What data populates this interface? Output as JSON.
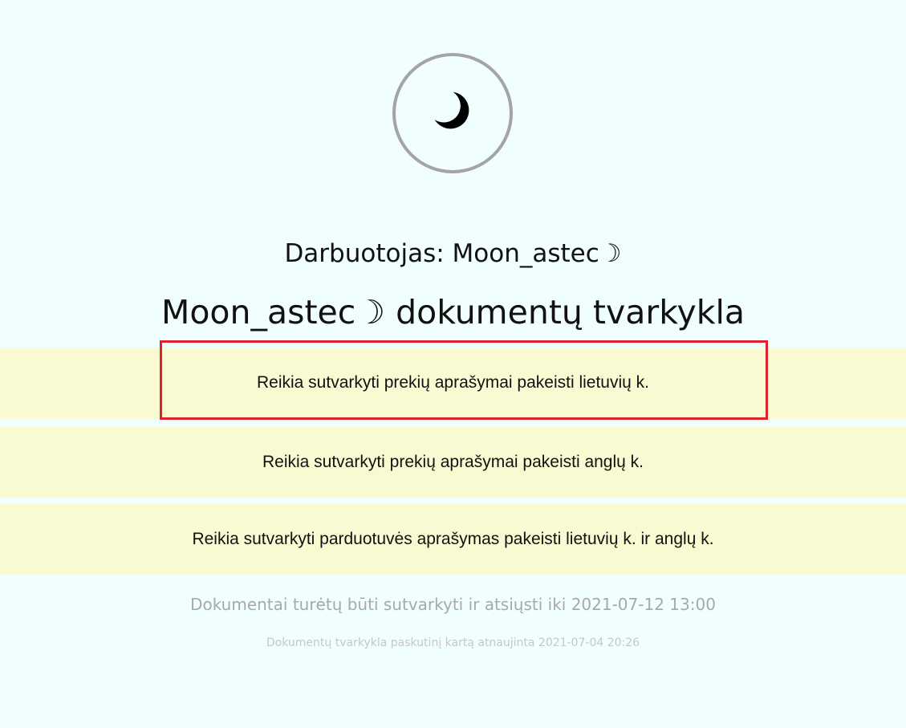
{
  "avatar": {
    "icon": "crescent-moon-icon"
  },
  "worker": {
    "label": "Darbuotojas: Moon_astec☽"
  },
  "title": "Moon_astec☽ dokumentų tvarkykla",
  "tasks": [
    {
      "text": "Reikia sutvarkyti prekių aprašymai pakeisti lietuvių k."
    },
    {
      "text": "Reikia sutvarkyti prekių aprašymai pakeisti anglų k."
    },
    {
      "text": "Reikia sutvarkyti parduotuvės aprašymas pakeisti lietuvių k. ir anglų k."
    }
  ],
  "deadline": "Dokumentai turėtų būti sutvarkyti ir atsiųsti iki 2021-07-12 13:00",
  "updated": "Dokumentų tvarkykla paskutinį kartą atnaujinta 2021-07-04 20:26",
  "colors": {
    "background": "#f0fffe",
    "task_background": "#fafad2",
    "highlight": "#e0202a",
    "avatar_border": "#a4a4a4"
  }
}
